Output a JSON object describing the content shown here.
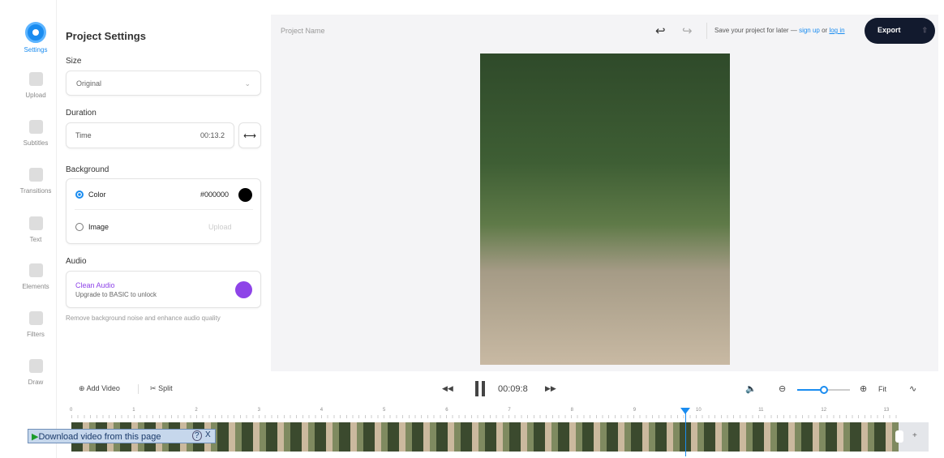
{
  "sidebar": {
    "items": [
      {
        "label": "Settings"
      },
      {
        "label": "Upload"
      },
      {
        "label": "Subtitles"
      },
      {
        "label": "Transitions"
      },
      {
        "label": "Text"
      },
      {
        "label": "Elements"
      },
      {
        "label": "Filters"
      },
      {
        "label": "Draw"
      }
    ]
  },
  "panel": {
    "title": "Project Settings",
    "size_label": "Size",
    "size_value": "Original",
    "duration_label": "Duration",
    "time_label": "Time",
    "time_value": "00:13.2",
    "background_label": "Background",
    "color_option": "Color",
    "color_value": "#000000",
    "image_option": "Image",
    "upload_label": "Upload",
    "audio_label": "Audio",
    "clean_audio": "Clean Audio",
    "upgrade_text": "Upgrade to BASIC to unlock",
    "audio_desc": "Remove background noise and enhance audio quality"
  },
  "header": {
    "project_name": "Project Name",
    "save_text": "Save your project for later —",
    "sign_up": "sign up",
    "or": "or",
    "log_in": "log in",
    "export": "Export"
  },
  "toolbar": {
    "add_video": "Add Video",
    "split": "Split",
    "current_time": "00:09:8",
    "fit": "Fit",
    "zoom_level_fraction": 0.5
  },
  "timeline": {
    "ticks": [
      "0",
      "1",
      "2",
      "3",
      "4",
      "5",
      "6",
      "7",
      "8",
      "9",
      "10",
      "11",
      "12",
      "13"
    ],
    "playhead_seconds": 9.8
  },
  "overlay": {
    "download": "Download video from this page",
    "help": "?",
    "close": "X"
  },
  "colors": {
    "accent": "#1a8cf0",
    "export_bg": "#121a2e",
    "purple": "#8e44e8"
  }
}
